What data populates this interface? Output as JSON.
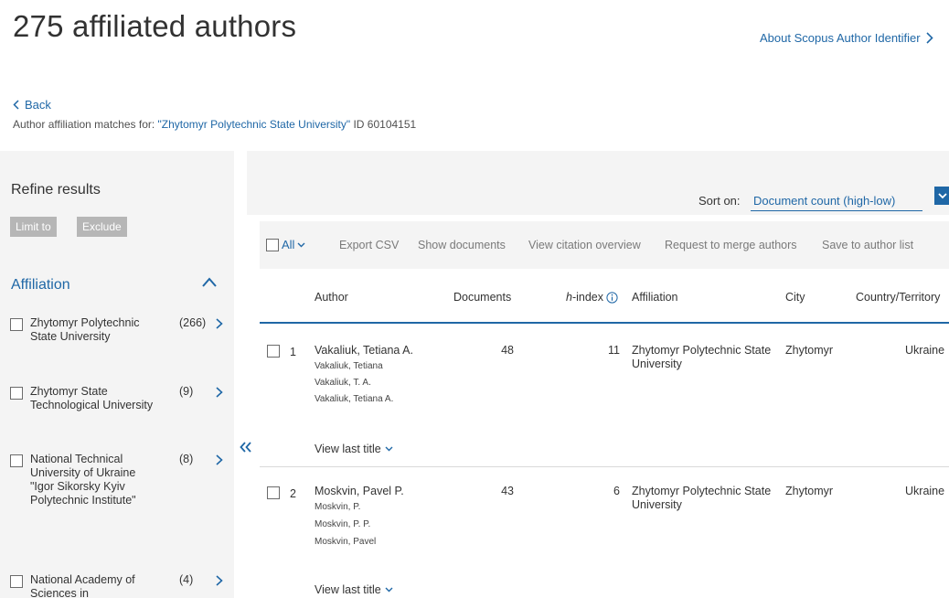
{
  "header": {
    "title": "275 affiliated authors",
    "about_link": "About Scopus Author Identifier",
    "back_label": "Back",
    "match_prefix": "Author affiliation matches for: ",
    "match_query": "\"Zhytomyr Polytechnic State University\"",
    "match_suffix": " ID 60104151"
  },
  "sidebar": {
    "title": "Refine results",
    "limit_label": "Limit to",
    "exclude_label": "Exclude",
    "facet_title": "Affiliation",
    "facets": [
      {
        "label": "Zhytomyr Polytechnic State University",
        "count": "(266)"
      },
      {
        "label": "Zhytomyr State Technological University",
        "count": "(9)"
      },
      {
        "label": "National Technical University of Ukraine \"Igor Sikorsky Kyiv Polytechnic Institute\"",
        "count": "(8)"
      },
      {
        "label": "National Academy of Sciences in",
        "count": "(4)"
      }
    ]
  },
  "sort": {
    "label": "Sort on:",
    "value": "Document count (high-low)"
  },
  "toolbar": {
    "all_label": "All",
    "export_csv": "Export CSV",
    "show_documents": "Show documents",
    "view_citation_overview": "View citation overview",
    "request_merge": "Request to merge authors",
    "save_list": "Save to author list"
  },
  "table": {
    "headers": {
      "author": "Author",
      "documents": "Documents",
      "h_index": "h-index",
      "h_index_suffix": "-index",
      "affiliation": "Affiliation",
      "city": "City",
      "country": "Country/Territory"
    },
    "rows": [
      {
        "num": "1",
        "name": "Vakaliuk, Tetiana A.",
        "aliases": [
          "Vakaliuk, Tetiana",
          "Vakaliuk, T. A.",
          "Vakaliuk, Tetiana A."
        ],
        "documents": "48",
        "h_index": "11",
        "affiliation": "Zhytomyr Polytechnic State University",
        "city": "Zhytomyr",
        "country": "Ukraine",
        "view_last": "View last title"
      },
      {
        "num": "2",
        "name": "Moskvin, Pavel P.",
        "aliases": [
          "Moskvin, P.",
          "Moskvin, P. P.",
          "Moskvin, Pavel"
        ],
        "documents": "43",
        "h_index": "6",
        "affiliation": "Zhytomyr Polytechnic State University",
        "city": "Zhytomyr",
        "country": "Ukraine",
        "view_last": "View last title"
      }
    ]
  },
  "colors": {
    "accent": "#1f67a6",
    "panel_bg": "#f4f4f4",
    "disabled_button": "#b6b6b6"
  }
}
